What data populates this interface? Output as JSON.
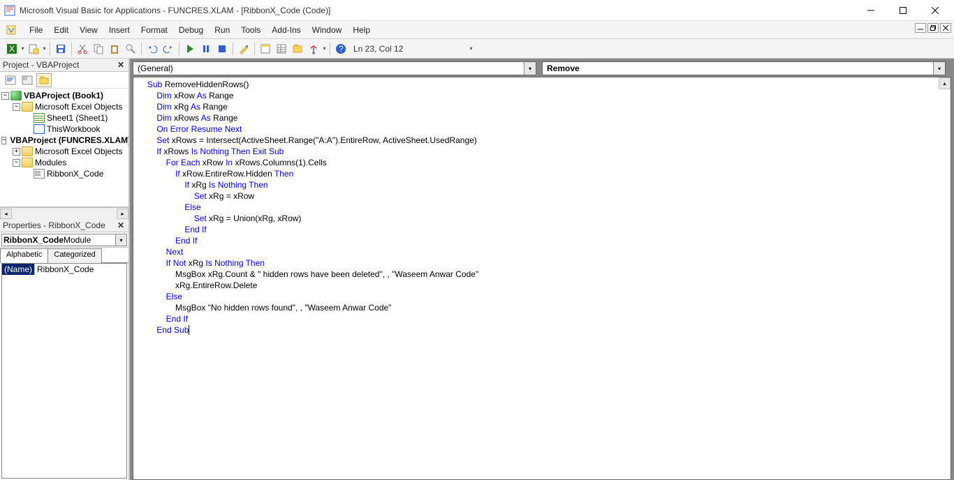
{
  "window": {
    "title": "Microsoft Visual Basic for Applications - FUNCRES.XLAM - [RibbonX_Code (Code)]"
  },
  "menus": [
    "File",
    "Edit",
    "View",
    "Insert",
    "Format",
    "Debug",
    "Run",
    "Tools",
    "Add-Ins",
    "Window",
    "Help"
  ],
  "toolbar_status": "Ln 23, Col 12",
  "project_pane": {
    "title": "Project - VBAProject",
    "tree": {
      "proj1": {
        "label": "VBAProject (Book1)"
      },
      "meo1": {
        "label": "Microsoft Excel Objects"
      },
      "sheet1": {
        "label": "Sheet1 (Sheet1)"
      },
      "thiswb": {
        "label": "ThisWorkbook"
      },
      "proj2": {
        "label": "VBAProject (FUNCRES.XLAM)"
      },
      "meo2": {
        "label": "Microsoft Excel Objects"
      },
      "mods": {
        "label": "Modules"
      },
      "rxc": {
        "label": "RibbonX_Code"
      }
    }
  },
  "properties_pane": {
    "title": "Properties - RibbonX_Code",
    "selector": "RibbonX_Code Module",
    "selector_name": "RibbonX_Code",
    "selector_type": " Module",
    "tabs": {
      "alpha": "Alphabetic",
      "cat": "Categorized"
    },
    "row": {
      "key": "(Name)",
      "value": "RibbonX_Code"
    }
  },
  "code_dropdowns": {
    "left": "(General)",
    "right": "Remove"
  },
  "code_tokens": {
    "Sub": "Sub",
    "proc": "RemoveHiddenRows()",
    "Dim": "Dim",
    "As": "As",
    "Range": "Range",
    "xRow": "xRow",
    "xRg": "xRg",
    "xRows": "xRows",
    "OnErrorResumeNext": "On Error Resume Next",
    "Set": "Set",
    "eq": " = ",
    "Intersect": "Intersect(ActiveSheet.Range(",
    "aa": "\"A:A\"",
    "rest1": ").EntireRow, ActiveSheet.UsedRange)",
    "If": "If",
    "Is": "Is",
    "Nothing": "Nothing",
    "Then": "Then",
    "ExitSub": "Exit Sub",
    "For": "For",
    "Each": "Each",
    "In": "In",
    "cols": "xRows.Columns(1).Cells",
    "hid": "xRow.EntireRow.Hidden",
    "setxrgxrow": "xRg = xRow",
    "Else": "Else",
    "union": "xRg = Union(xRg, xRow)",
    "EndIf": "End If",
    "Next": "Next",
    "Not": "Not",
    "msg1a": "MsgBox xRg.Count & ",
    "msg1s": "\" hidden rows have been deleted\"",
    "msg1b": ", , ",
    "msg1c": "\"Waseem Anwar Code\"",
    "del": "xRg.EntireRow.Delete",
    "msg2a": "MsgBox ",
    "msg2s": "\"No hidden rows found\"",
    "msg2b": ", , ",
    "msg2c": "\"Waseem Anwar Code\"",
    "EndSub": "End Sub"
  }
}
